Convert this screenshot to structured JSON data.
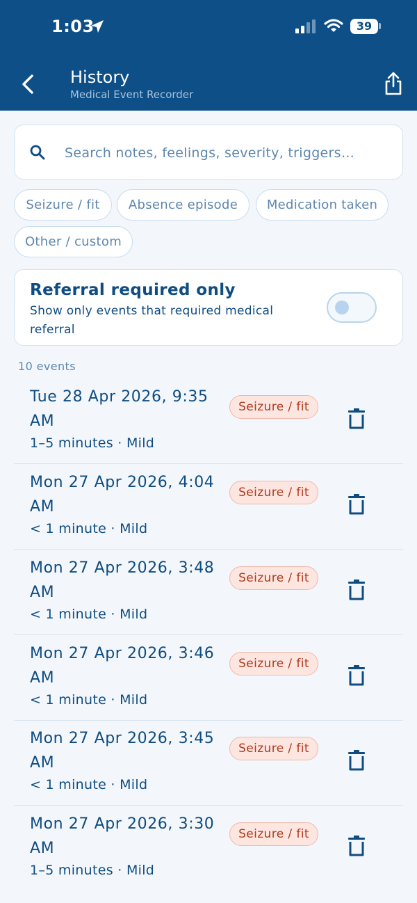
{
  "status_bar": {
    "time": "1:03",
    "battery": "39"
  },
  "header": {
    "title": "History",
    "subtitle": "Medical Event Recorder"
  },
  "search": {
    "placeholder": "Search notes, feelings, severity, triggers…"
  },
  "filters": [
    {
      "label": "Seizure / fit"
    },
    {
      "label": "Absence episode"
    },
    {
      "label": "Medication taken"
    },
    {
      "label": "Other / custom"
    }
  ],
  "referral": {
    "title": "Referral required only",
    "description": "Show only events that required medical referral",
    "enabled": false
  },
  "event_count": "10 events",
  "events": [
    {
      "date": "Tue 28 Apr 2026, 9:35 AM",
      "meta": "1–5 minutes · Mild",
      "type": "Seizure / fit"
    },
    {
      "date": "Mon 27 Apr 2026, 4:04 AM",
      "meta": "< 1 minute · Mild",
      "type": "Seizure / fit"
    },
    {
      "date": "Mon 27 Apr 2026, 3:48 AM",
      "meta": "< 1 minute · Mild",
      "type": "Seizure / fit"
    },
    {
      "date": "Mon 27 Apr 2026, 3:46 AM",
      "meta": "< 1 minute · Mild",
      "type": "Seizure / fit"
    },
    {
      "date": "Mon 27 Apr 2026, 3:45 AM",
      "meta": "< 1 minute · Mild",
      "type": "Seizure / fit"
    },
    {
      "date": "Mon 27 Apr 2026, 3:30 AM",
      "meta": "1–5 minutes · Mild",
      "type": "Seizure / fit"
    }
  ],
  "icons": {
    "back": "chevron-left-icon",
    "share": "share-icon",
    "search": "search-icon",
    "delete": "trash-icon",
    "location": "location-arrow-icon",
    "signal": "cellular-signal-icon",
    "wifi": "wifi-icon",
    "battery": "battery-icon"
  },
  "colors": {
    "header_bg": "#0d4f86",
    "primary_text": "#0f4c81",
    "muted_text": "#5d86ad",
    "tag_bg": "#fde6e0",
    "tag_text": "#b0391f",
    "page_bg": "#f3f7fb"
  }
}
